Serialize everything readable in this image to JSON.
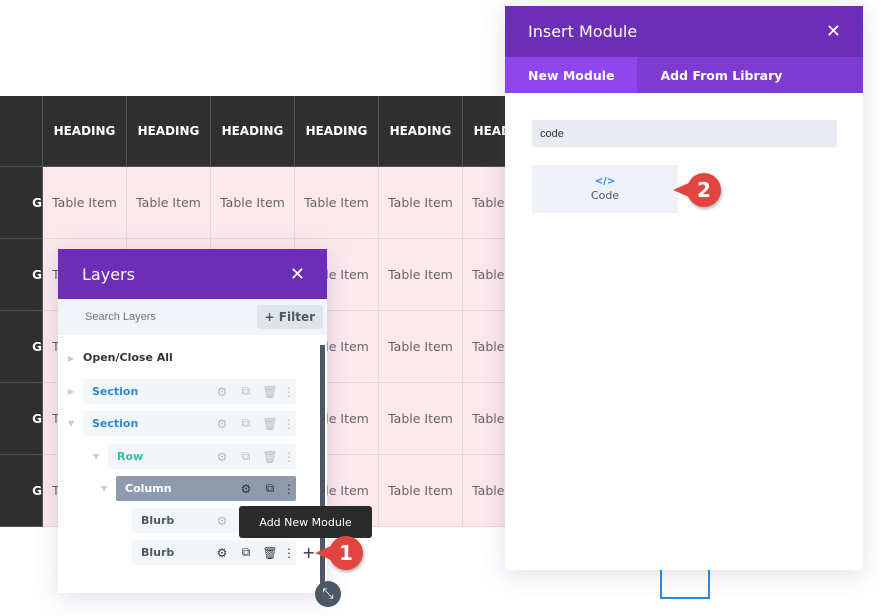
{
  "table": {
    "headers": [
      "HEADING",
      "HEADING",
      "HEADING",
      "HEADING",
      "HEADING",
      "HEADING"
    ],
    "row_label": "G",
    "cell": "Table Item",
    "row_count": 5
  },
  "layers": {
    "title": "Layers",
    "search_placeholder": "Search Layers",
    "filter": "+ Filter",
    "open_close": "Open/Close All",
    "items": [
      {
        "label": "Section",
        "color": "#2b87da"
      },
      {
        "label": "Section",
        "color": "#2b87da"
      },
      {
        "label": "Row",
        "color": "#29c4a9"
      },
      {
        "label": "Column",
        "color": "#ffffff"
      },
      {
        "label": "Blurb",
        "color": "#4c5866"
      },
      {
        "label": "Blurb",
        "color": "#4c5866"
      }
    ],
    "tooltip": "Add New Module",
    "add_icon": "+"
  },
  "insert": {
    "title": "Insert Module",
    "tabs": [
      "New Module",
      "Add From Library"
    ],
    "search_value": "code",
    "module_label": "Code",
    "module_icon": "</>"
  },
  "badges": [
    "1",
    "2"
  ],
  "colors": {
    "purple": "#6c2eb9",
    "tab": "#7e3bd0",
    "accent": "#2b87da",
    "badge": "#e0463f"
  }
}
